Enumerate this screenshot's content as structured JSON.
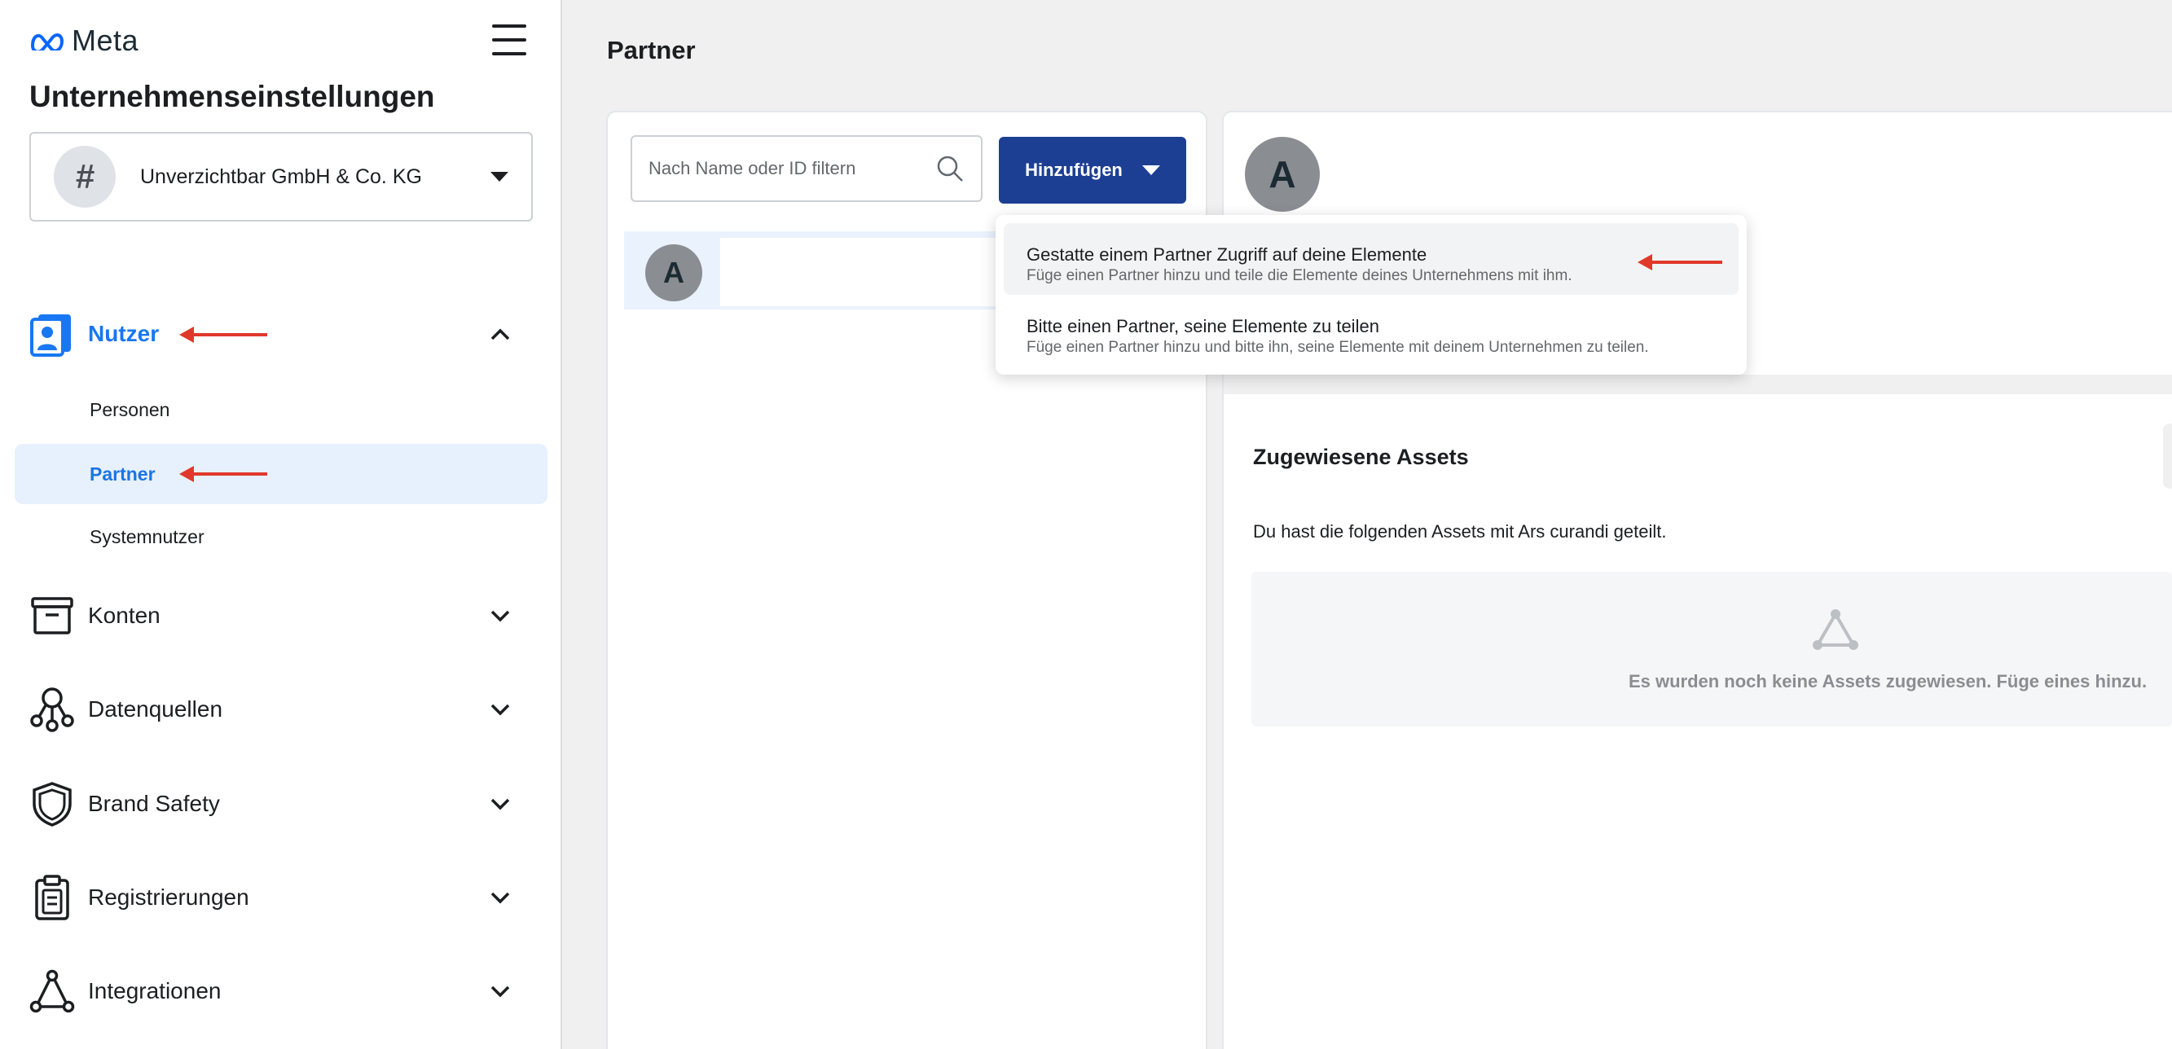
{
  "brand": {
    "name": "Meta"
  },
  "sidebar": {
    "title": "Unternehmenseinstellungen",
    "business": {
      "initial": "#",
      "name": "Unverzichtbar GmbH & Co. KG"
    },
    "groups": [
      {
        "label": "Nutzer",
        "icon": "users-icon",
        "expanded": true
      },
      {
        "label": "Konten",
        "icon": "accounts-icon"
      },
      {
        "label": "Datenquellen",
        "icon": "data-sources-icon"
      },
      {
        "label": "Brand Safety",
        "icon": "shield-icon"
      },
      {
        "label": "Registrierungen",
        "icon": "clipboard-icon"
      },
      {
        "label": "Integrationen",
        "icon": "integrations-icon"
      }
    ],
    "sub_items": [
      {
        "label": "Personen"
      },
      {
        "label": "Partner",
        "selected": true
      },
      {
        "label": "Systemnutzer"
      }
    ]
  },
  "main": {
    "title": "Partner",
    "search": {
      "placeholder": "Nach Name oder ID filtern"
    },
    "add_button": {
      "label": "Hinzufügen"
    },
    "list": [
      {
        "initial": "A"
      }
    ],
    "detail": {
      "initial": "A",
      "assets_title": "Zugewiesene Assets",
      "assets_desc": "Du hast die folgenden Assets mit Ars curandi geteilt.",
      "assets_empty": "Es wurden noch keine Assets zugewiesen. Füge eines hinzu."
    }
  },
  "dropdown": {
    "items": [
      {
        "title": "Gestatte einem Partner Zugriff auf deine Elemente",
        "subtitle": "Füge einen Partner hinzu und teile die Elemente deines Unternehmens mit ihm."
      },
      {
        "title": "Bitte einen Partner, seine Elemente zu teilen",
        "subtitle": "Füge einen Partner hinzu und bitte ihn, seine Elemente mit deinem Unternehmen zu teilen."
      }
    ]
  },
  "colors": {
    "accent": "#1877f2",
    "button": "#1c3f94",
    "annotation_arrow": "#e0392b",
    "selected_bg": "#e7f0fd"
  }
}
